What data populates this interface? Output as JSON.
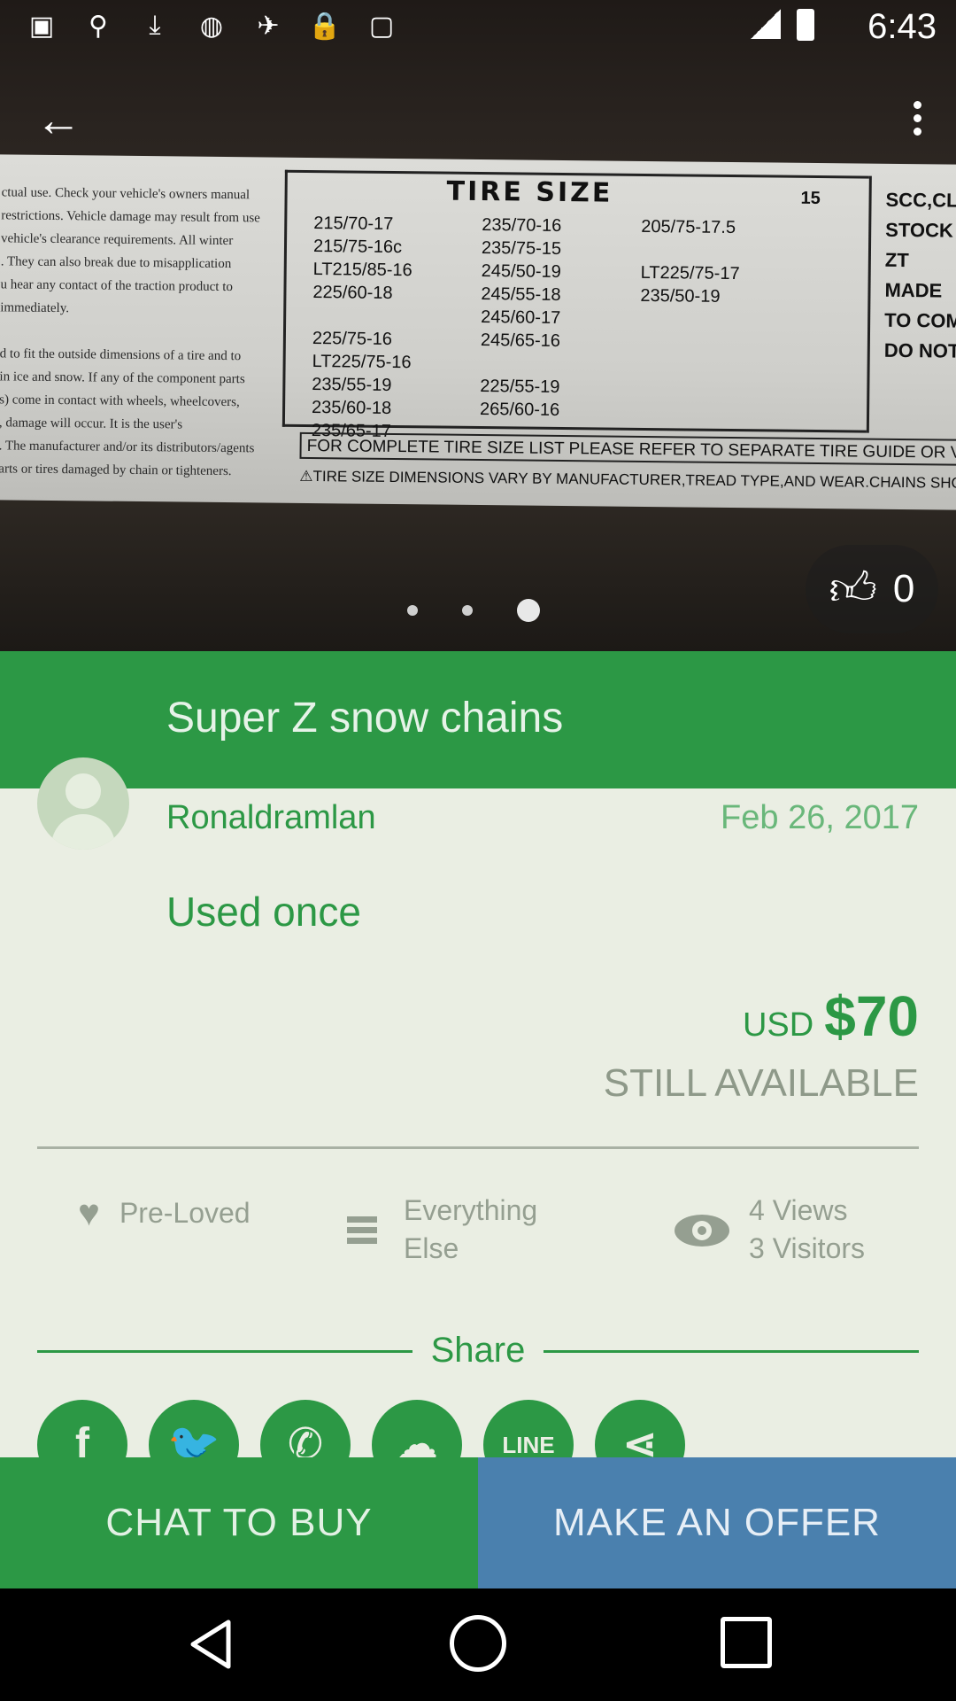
{
  "status_bar": {
    "time": "6:43",
    "left_icons": [
      "facebook-notification-icon",
      "pin-icon",
      "download-icon",
      "adjust-icon",
      "fake-gps-icon",
      "lock-icon",
      "android-icon"
    ]
  },
  "photo": {
    "sheet": {
      "left_text": "ctual use. Check your vehicle's owners manual\nrestrictions. Vehicle damage may result from use\nvehicle's clearance requirements. All winter\n. They can also break due to misapplication\nu hear any contact of the traction product to\nimmediately.\n\nd to fit the outside dimensions of a tire and to\nin ice and snow. If any of the component parts\ns) come in contact with wheels, wheelcovers,\n, damage will occur. It is the user's\n. The manufacturer and/or its distributors/agents\narts or tires damaged by chain or tighteners.",
      "heading": "TIRE SIZE",
      "number": "15",
      "col1": "215/70-17\n215/75-16c\nLT215/85-16\n225/60-18\n\n225/75-16\nLT225/75-16\n235/55-19\n235/60-18\n235/65-17",
      "col2": "235/70-16\n235/75-15\n245/50-19\n245/55-18\n245/60-17\n245/65-16\n\n225/55-19\n265/60-16",
      "col3": "205/75-17.5\n\nLT225/75-17\n235/50-19",
      "right_text": "SCC,CL\nSTOCK\nZT\nMADE\nTO COMPLY\nDO NOT E",
      "refer_line": "FOR COMPLETE TIRE SIZE LIST PLEASE REFER TO SEPARATE TIRE GUIDE OR VIS",
      "warn_line": "⚠TIRE SIZE DIMENSIONS VARY BY MANUFACTURER,TREAD TYPE,AND WEAR.CHAINS SHOULD B"
    },
    "pager": {
      "count": 3,
      "active_index": 2
    },
    "likes": "0"
  },
  "listing": {
    "title": "Super Z snow chains",
    "seller": "Ronaldramlan",
    "date": "Feb 26, 2017",
    "description": "Used once",
    "currency": "USD",
    "price": "$70",
    "availability": "STILL AVAILABLE",
    "condition": "Pre-Loved",
    "category_line1": "Everything",
    "category_line2": "Else",
    "views": "4 Views",
    "visitors": "3 Visitors"
  },
  "share": {
    "label": "Share",
    "services": [
      {
        "name": "facebook",
        "glyph": "f"
      },
      {
        "name": "twitter",
        "glyph": "🐦"
      },
      {
        "name": "phone",
        "glyph": "✆"
      },
      {
        "name": "wechat",
        "glyph": "☁"
      },
      {
        "name": "line",
        "glyph": "LINE"
      },
      {
        "name": "share",
        "glyph": "⋖"
      }
    ]
  },
  "actions": {
    "chat": "CHAT TO BUY",
    "offer": "MAKE AN OFFER"
  },
  "colors": {
    "brand_green": "#2c9845",
    "offer_blue": "#4a80ae",
    "content_bg": "#eaeee3"
  }
}
